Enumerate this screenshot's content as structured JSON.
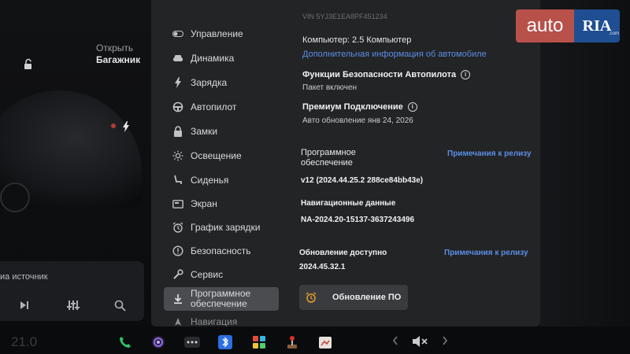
{
  "left": {
    "trunk_line1": "Открыть",
    "trunk_line2": "Багажник",
    "media_source": "иа источник"
  },
  "menu": {
    "items": [
      {
        "label": "Управление",
        "icon": "toggle-icon"
      },
      {
        "label": "Динамика",
        "icon": "car-icon"
      },
      {
        "label": "Зарядка",
        "icon": "bolt-icon"
      },
      {
        "label": "Автопилот",
        "icon": "steering-wheel-icon"
      },
      {
        "label": "Замки",
        "icon": "lock-icon"
      },
      {
        "label": "Освещение",
        "icon": "sun-icon"
      },
      {
        "label": "Сиденья",
        "icon": "seat-icon"
      },
      {
        "label": "Экран",
        "icon": "screen-icon"
      },
      {
        "label": "График зарядки",
        "icon": "alarm-clock-icon"
      },
      {
        "label": "Безопасность",
        "icon": "info-circle-icon"
      },
      {
        "label": "Сервис",
        "icon": "wrench-icon"
      },
      {
        "label_line1": "Программное",
        "label_line2": "обеспечение",
        "icon": "download-icon",
        "active": true
      },
      {
        "label": "Навигация",
        "icon": "navigation-icon"
      }
    ]
  },
  "content": {
    "faded_top": "VIN 5YJ3E1EA8PF451234",
    "computer": "Компьютер: 2.5 Компьютер",
    "more_info_link": "Дополнительная информация об автомобиле",
    "autopilot_title": "Функции Безопасности Автопилота",
    "autopilot_status": "Пакет включен",
    "premium_title": "Премиум Подключение",
    "premium_status": "Авто обновление янв 24, 2026",
    "software_title_line1": "Программное",
    "software_title_line2": "обеспечение",
    "release_notes_1": "Примечания к релизу",
    "software_version": "v12 (2024.44.25.2 288ce84bb43e)",
    "nav_data_title": "Навигационные данные",
    "nav_data_value": "NA-2024.20-15137-3637243496",
    "update_available_title": "Обновление доступно",
    "release_notes_2": "Примечания к релизу",
    "update_version": "2024.45.32.1",
    "update_button": "Обновление ПО"
  },
  "taskbar": {
    "temp": "21.0",
    "icons": [
      "phone-icon",
      "camera-icon",
      "more-icon",
      "bluetooth-icon",
      "games-icon",
      "joystick-icon",
      "toybox-icon",
      "volume-mute-icon"
    ]
  },
  "watermark": {
    "auto": "auto",
    "ria": "RIA",
    "com": ".com"
  },
  "colors": {
    "link": "#5b8ee6",
    "panel": "#232426",
    "active": "#4a4c50",
    "alarm": "#e3a32a",
    "logo_red": "#b8514a",
    "logo_blue": "#1f4f92"
  }
}
